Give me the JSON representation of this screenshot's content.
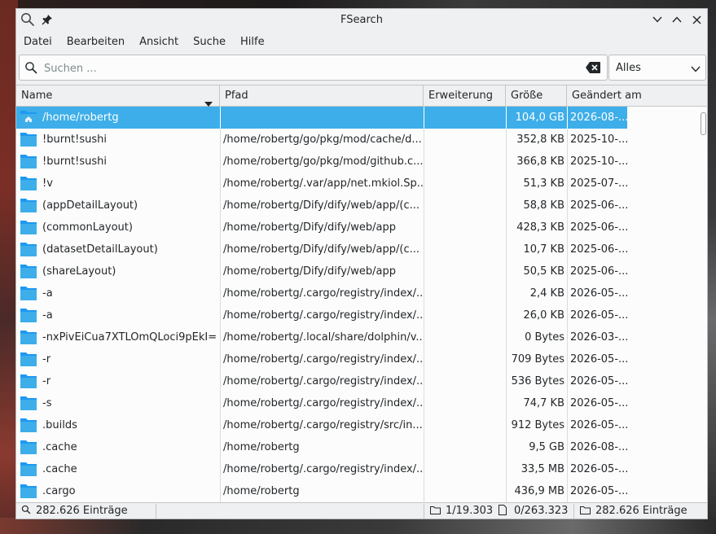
{
  "window": {
    "title": "FSearch"
  },
  "menu": [
    "Datei",
    "Bearbeiten",
    "Ansicht",
    "Suche",
    "Hilfe"
  ],
  "search": {
    "placeholder": "Suchen ...",
    "value": "",
    "filter": "Alles"
  },
  "columns": {
    "name": "Name",
    "path": "Pfad",
    "extension": "Erweiterung",
    "size": "Größe",
    "modified": "Geändert am"
  },
  "rows": [
    {
      "name": "/home/robertg",
      "path": "",
      "ext": "",
      "size": "104,0 GB",
      "date": "2026-08-...",
      "selected": true,
      "home": true
    },
    {
      "name": "!burnt!sushi",
      "path": "/home/robertg/go/pkg/mod/cache/d...",
      "ext": "",
      "size": "352,8 KB",
      "date": "2025-10-..."
    },
    {
      "name": "!burnt!sushi",
      "path": "/home/robertg/go/pkg/mod/github.c...",
      "ext": "",
      "size": "366,8 KB",
      "date": "2025-10-..."
    },
    {
      "name": "!v",
      "path": "/home/robertg/.var/app/net.mkiol.Sp...",
      "ext": "",
      "size": "51,3 KB",
      "date": "2025-07-..."
    },
    {
      "name": "(appDetailLayout)",
      "path": "/home/robertg/Dify/dify/web/app/(c...",
      "ext": "",
      "size": "58,8 KB",
      "date": "2025-06-..."
    },
    {
      "name": "(commonLayout)",
      "path": "/home/robertg/Dify/dify/web/app",
      "ext": "",
      "size": "428,3 KB",
      "date": "2025-06-..."
    },
    {
      "name": "(datasetDetailLayout)",
      "path": "/home/robertg/Dify/dify/web/app/(c...",
      "ext": "",
      "size": "10,7 KB",
      "date": "2025-06-..."
    },
    {
      "name": "(shareLayout)",
      "path": "/home/robertg/Dify/dify/web/app",
      "ext": "",
      "size": "50,5 KB",
      "date": "2025-06-..."
    },
    {
      "name": "-a",
      "path": "/home/robertg/.cargo/registry/index/...",
      "ext": "",
      "size": "2,4 KB",
      "date": "2026-05-..."
    },
    {
      "name": "-a",
      "path": "/home/robertg/.cargo/registry/index/...",
      "ext": "",
      "size": "26,0 KB",
      "date": "2026-05-..."
    },
    {
      "name": "-nxPivEiCua7XTLOmQLoci9pEkI=",
      "path": "/home/robertg/.local/share/dolphin/v...",
      "ext": "",
      "size": "0 Bytes",
      "date": "2026-03-..."
    },
    {
      "name": "-r",
      "path": "/home/robertg/.cargo/registry/index/...",
      "ext": "",
      "size": "709 Bytes",
      "date": "2026-05-..."
    },
    {
      "name": "-r",
      "path": "/home/robertg/.cargo/registry/index/...",
      "ext": "",
      "size": "536 Bytes",
      "date": "2026-05-..."
    },
    {
      "name": "-s",
      "path": "/home/robertg/.cargo/registry/index/...",
      "ext": "",
      "size": "74,7 KB",
      "date": "2026-05-..."
    },
    {
      "name": ".builds",
      "path": "/home/robertg/.cargo/registry/src/in...",
      "ext": "",
      "size": "912 Bytes",
      "date": "2026-05-..."
    },
    {
      "name": ".cache",
      "path": "/home/robertg",
      "ext": "",
      "size": "9,5 GB",
      "date": "2026-08-..."
    },
    {
      "name": ".cache",
      "path": "/home/robertg/.cargo/registry/index/...",
      "ext": "",
      "size": "33,5 MB",
      "date": "2026-05-..."
    },
    {
      "name": ".cargo",
      "path": "/home/robertg",
      "ext": "",
      "size": "436,9 MB",
      "date": "2026-05-..."
    }
  ],
  "status": {
    "entries_left": "282.626 Einträge",
    "folders_selected": "1/19.303",
    "files_selected": "0/263.323",
    "entries_right": "282.626 Einträge"
  },
  "icons": {
    "search": "search-icon",
    "pin": "pin-icon",
    "minimize": "chevron-down-icon",
    "maximize": "chevron-up-icon",
    "close": "close-icon",
    "clear": "backspace-icon",
    "folder": "folder-icon",
    "file": "file-icon"
  },
  "colors": {
    "accent": "#3daee9",
    "folder": "#3daee9",
    "window_bg": "#eff0f1",
    "view_bg": "#fcfcfc"
  }
}
